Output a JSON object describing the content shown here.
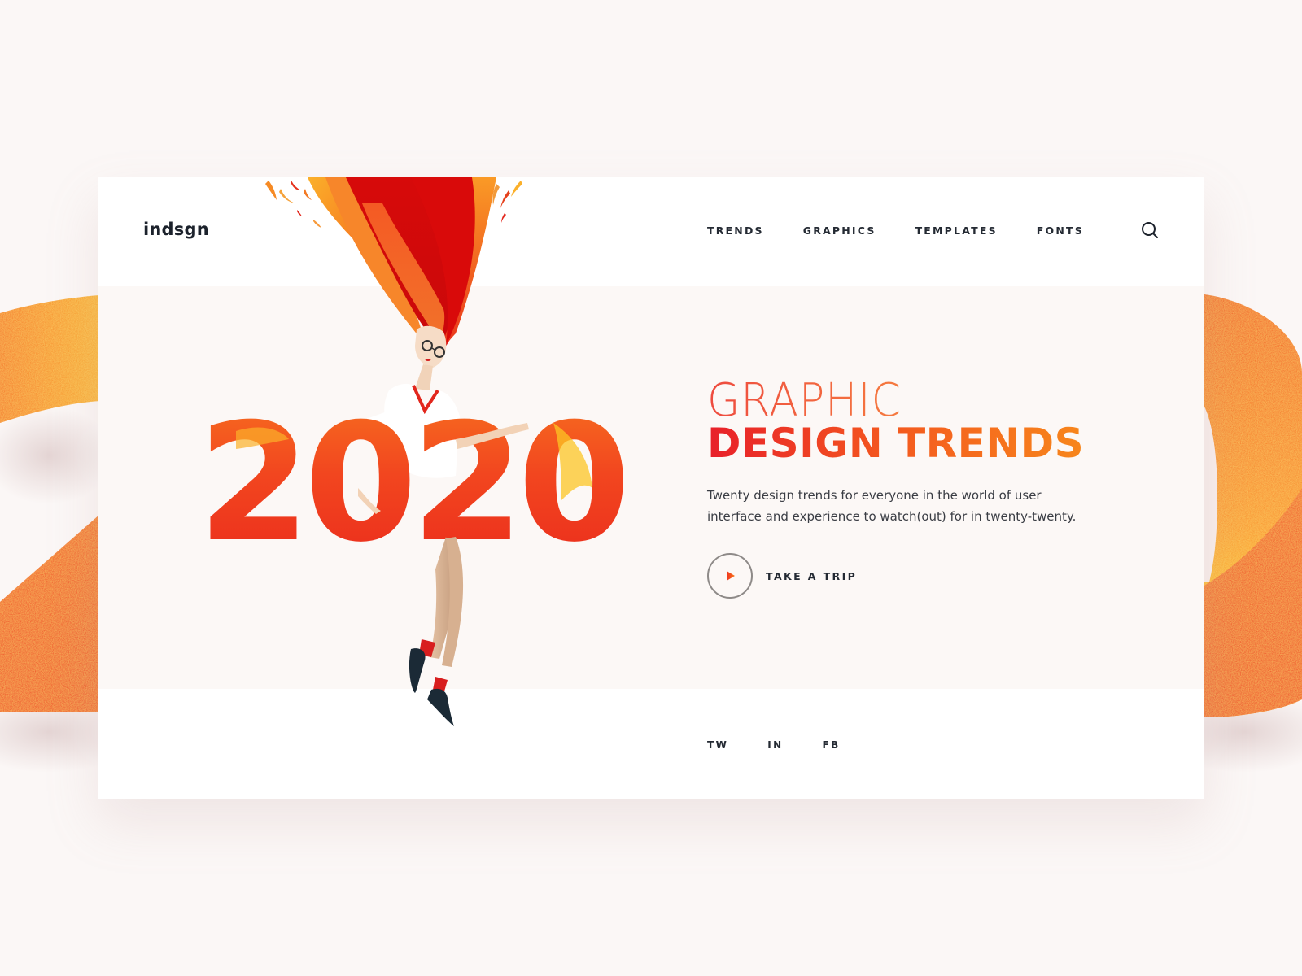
{
  "brand": {
    "logo": "indsgn",
    "accent_red": "#e8202a",
    "accent_orange": "#f7861c",
    "text_dark": "#242a33"
  },
  "nav": {
    "items": [
      {
        "label": "TRENDS"
      },
      {
        "label": "GRAPHICS"
      },
      {
        "label": "TEMPLATES"
      },
      {
        "label": "FONTS"
      }
    ],
    "search_icon": "search-icon"
  },
  "hero": {
    "illustration_year": "2020",
    "headline_light": "GRAPHIC",
    "headline_bold": "DESIGN TRENDS",
    "description_line1": "Twenty design trends for everyone in the world of user",
    "description_line2": "interface and experience to watch(out) for in twenty-twenty.",
    "cta_label": "TAKE A TRIP",
    "cta_icon": "play-icon"
  },
  "footer": {
    "social": [
      {
        "label": "TW"
      },
      {
        "label": "IN"
      },
      {
        "label": "FB"
      }
    ]
  }
}
